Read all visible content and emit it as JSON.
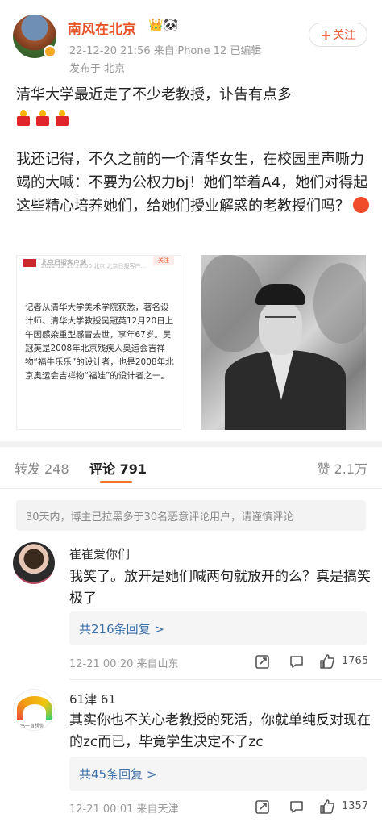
{
  "post": {
    "author": "南风在北京",
    "badge_icons": "👑🐼",
    "meta": "22-12-20 21:56  来自iPhone 12  已编辑",
    "location": "发布于 北京",
    "follow_label": "关注",
    "title": "清华大学最近走了不少老教授，讣告有点多",
    "body": "我还记得，不久之前的一个清华女生，在校园里声嘶力竭的大喊：不要为公权力bj！她们举着A4，她们对得起这些精心培养她们，给她们授业解惑的老教授们吗？",
    "emoji_candles": [
      "candle-icon",
      "candle-icon",
      "candle-icon"
    ],
    "image_left": {
      "header_name": "北京日报客户端",
      "header_meta": "2022-12-20 20:50  北京  北京日报客户...",
      "follow_label": "关注",
      "excerpt": "记者从清华大学美术学院获悉，著名设计师、清华大学教授吴冠英12月20日上午因感染重型感冒去世，享年67岁。吴冠英是2008年北京残疾人奥运会吉祥物“福牛乐乐”的设计者，也是2008年北京奥运会吉祥物“福娃”的设计者之一。"
    }
  },
  "tabs": {
    "reposts_label": "转发",
    "reposts_count": "248",
    "comments_label": "评论",
    "comments_count": "791",
    "likes_label": "赞",
    "likes_count": "2.1万"
  },
  "notice": "30天内，博主已拉黑多于30名恶意评论用户，请谨慎评论",
  "comments": [
    {
      "name": "崔崔爱你们",
      "text": "我笑了。放开是她们喊两句就放开的么？真是搞笑极了",
      "replies": "共216条回复 >",
      "time": "12-21 00:20  来自山东",
      "likes": "1765"
    },
    {
      "name": "61津 61",
      "avatar_text": "鸣一直想你",
      "text": "其实你也不关心老教授的死活，你就单纯反对现在的zc而已，毕竟学生决定不了zc",
      "replies": "共45条回复 >",
      "time": "12-21 00:01  来自天津",
      "likes": "1357"
    }
  ]
}
